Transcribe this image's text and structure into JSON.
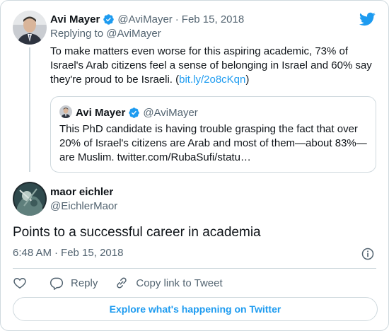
{
  "parent_tweet": {
    "display_name": "Avi Mayer",
    "handle": "@AviMayer",
    "separator": "·",
    "date": "Feb 15, 2018",
    "replying_prefix": "Replying to ",
    "replying_handle": "@AviMayer",
    "text": "To make matters even worse for this aspiring academic, 73% of Israel's Arab citizens feel a sense of belonging in Israel and 60% say they're proud to be Israeli. (",
    "link_text": "bit.ly/2o8cKqn",
    "text_suffix": ")"
  },
  "quoted_tweet": {
    "display_name": "Avi Mayer",
    "handle": "@AviMayer",
    "text": "This PhD candidate is having trouble grasping the fact that over 20% of Israel's citizens are Arab and most of them—about 83%—are Muslim. twitter.com/RubaSufi/statu…"
  },
  "main_tweet": {
    "display_name": "maor eichler",
    "handle": "@EichlerMaor",
    "text": "Points to a successful career in academia",
    "time": "6:48 AM",
    "separator": "·",
    "date": "Feb 15, 2018"
  },
  "actions": {
    "reply_label": "Reply",
    "copy_link_label": "Copy link to Tweet"
  },
  "explore_label": "Explore what's happening on Twitter",
  "icons": {
    "brand": "twitter-bird-icon",
    "verified": "verified-badge-icon",
    "info": "info-icon",
    "like": "heart-icon",
    "reply": "reply-icon",
    "copy_link": "link-icon"
  },
  "colors": {
    "accent": "#1d9bf0",
    "muted": "#536471",
    "border": "#cfd9de",
    "text": "#0f1419"
  }
}
